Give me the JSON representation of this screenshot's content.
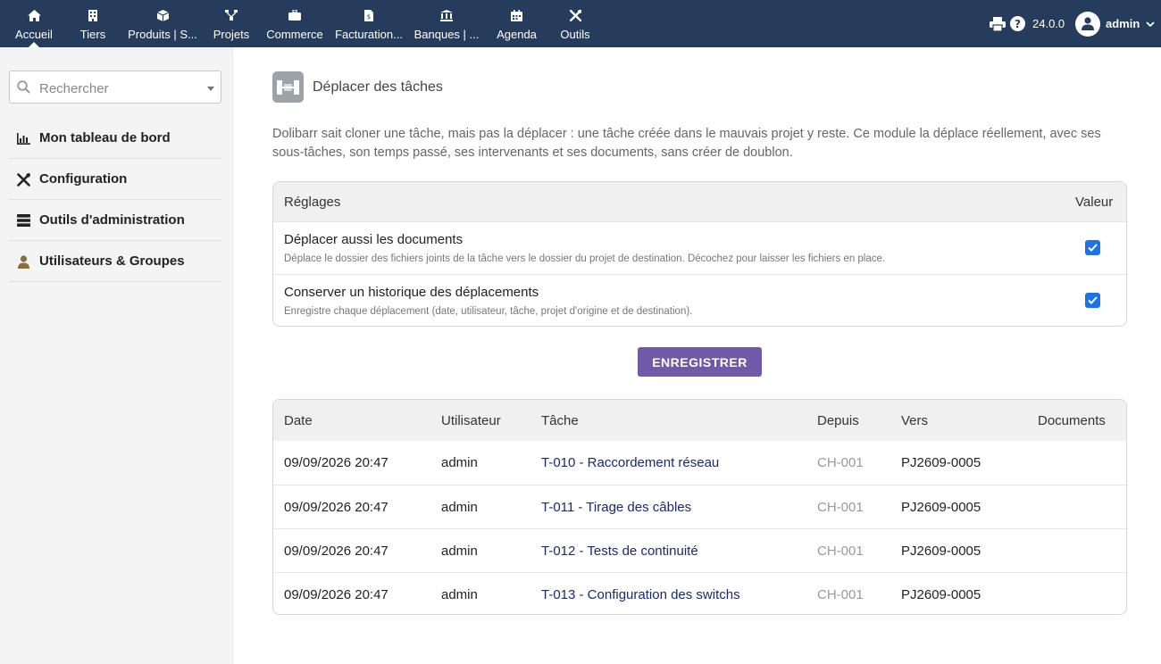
{
  "nav": {
    "items": [
      {
        "label": "Accueil",
        "icon": "home-icon"
      },
      {
        "label": "Tiers",
        "icon": "building-icon"
      },
      {
        "label": "Produits | S...",
        "icon": "cube-icon"
      },
      {
        "label": "Projets",
        "icon": "sitemap-icon"
      },
      {
        "label": "Commerce",
        "icon": "briefcase-icon"
      },
      {
        "label": "Facturation...",
        "icon": "invoice-icon"
      },
      {
        "label": "Banques | ...",
        "icon": "bank-icon"
      },
      {
        "label": "Agenda",
        "icon": "calendar-icon"
      },
      {
        "label": "Outils",
        "icon": "tools-icon"
      }
    ],
    "version": "24.0.0",
    "user": "admin"
  },
  "sidebar": {
    "search_placeholder": "Rechercher",
    "items": [
      {
        "label": "Mon tableau de bord",
        "icon": "chart-icon"
      },
      {
        "label": "Configuration",
        "icon": "tools-icon"
      },
      {
        "label": "Outils d'administration",
        "icon": "server-icon"
      },
      {
        "label": "Utilisateurs & Groupes",
        "icon": "user-icon"
      }
    ]
  },
  "page": {
    "title": "Déplacer des tâches",
    "description": "Dolibarr sait cloner une tâche, mais pas la déplacer : une tâche créée dans le mauvais projet y reste. Ce module la déplace réellement, avec ses sous-tâches, son temps passé, ses intervenants et ses documents, sans créer de doublon."
  },
  "settings": {
    "header_name": "Réglages",
    "header_value": "Valeur",
    "rows": [
      {
        "title": "Déplacer aussi les documents",
        "desc": "Déplace le dossier des fichiers joints de la tâche vers le dossier du projet de destination. Décochez pour laisser les fichiers en place.",
        "checked": true
      },
      {
        "title": "Conserver un historique des déplacements",
        "desc": "Enregistre chaque déplacement (date, utilisateur, tâche, projet d'origine et de destination).",
        "checked": true
      }
    ]
  },
  "save_label": "ENREGISTRER",
  "log": {
    "headers": {
      "date": "Date",
      "user": "Utilisateur",
      "task": "Tâche",
      "from": "Depuis",
      "to": "Vers",
      "docs": "Documents"
    },
    "rows": [
      {
        "date": "09/09/2026 20:47",
        "user": "admin",
        "task": "T-010 - Raccordement réseau",
        "from": "CH-001",
        "to": "PJ2609-0005",
        "docs": ""
      },
      {
        "date": "09/09/2026 20:47",
        "user": "admin",
        "task": "T-011 - Tirage des câbles",
        "from": "CH-001",
        "to": "PJ2609-0005",
        "docs": ""
      },
      {
        "date": "09/09/2026 20:47",
        "user": "admin",
        "task": "T-012 - Tests de continuité",
        "from": "CH-001",
        "to": "PJ2609-0005",
        "docs": ""
      },
      {
        "date": "09/09/2026 20:47",
        "user": "admin",
        "task": "T-013 - Configuration des switchs",
        "from": "CH-001",
        "to": "PJ2609-0005",
        "docs": ""
      }
    ]
  },
  "colors": {
    "topbar": "#263c5c",
    "accent_button": "#7059a8",
    "link": "#1a2a6c",
    "checkbox": "#1a73e8"
  }
}
